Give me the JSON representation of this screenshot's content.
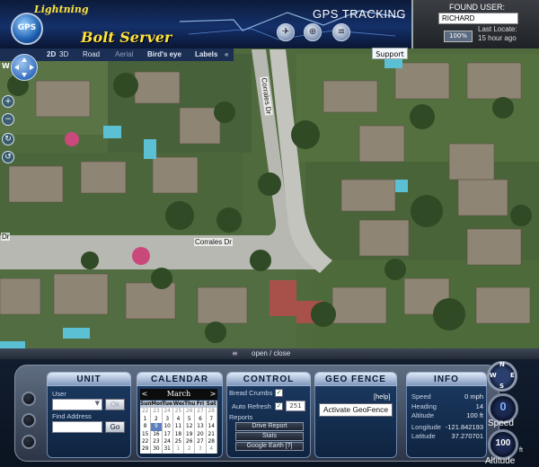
{
  "header": {
    "brand_script": "Lightning",
    "logo_text": "GPS",
    "brand_name": "Bolt Server",
    "title": "GPS TRACKING"
  },
  "found_user": {
    "label": "FOUND USER:",
    "value": "RICHARD",
    "zoom": "100%",
    "last_locate_label": "Last Locate:",
    "last_locate_value": "15 hour ago"
  },
  "map_tabs": [
    "2D",
    "3D",
    "Road",
    "Aerial",
    "Bird's eye",
    "Labels",
    "«"
  ],
  "support_label": "Support",
  "map": {
    "roads": [
      "Corrales Dr",
      "Corrales Dr",
      "Corrales Dr",
      "Dr"
    ],
    "nav_left_letter": "W"
  },
  "open_close_label": "open / close",
  "unit": {
    "title": "UNIT",
    "user_label": "User",
    "ok_label": "Ok",
    "find_address_label": "Find Address",
    "go_label": "Go",
    "user_value": "",
    "address_value": ""
  },
  "calendar": {
    "title": "CALENDAR",
    "month": "March",
    "prev": "<",
    "next": ">",
    "days": [
      "Sun",
      "Mon",
      "Tue",
      "Wed",
      "Thu",
      "Fri",
      "Sat"
    ],
    "weeks": [
      [
        "22",
        "23",
        "24",
        "25",
        "26",
        "27",
        "28"
      ],
      [
        "1",
        "2",
        "3",
        "4",
        "5",
        "6",
        "7"
      ],
      [
        "8",
        "9",
        "10",
        "11",
        "12",
        "13",
        "14"
      ],
      [
        "15",
        "16",
        "17",
        "18",
        "19",
        "20",
        "21"
      ],
      [
        "22",
        "23",
        "24",
        "25",
        "26",
        "27",
        "28"
      ],
      [
        "29",
        "30",
        "31",
        "1",
        "2",
        "3",
        "4"
      ]
    ]
  },
  "control": {
    "title": "CONTROL",
    "bread_crumbs_label": "Bread Crumbs",
    "auto_refresh_label": "Auto Refresh",
    "refresh_value": "251",
    "reports_label": "Reports",
    "drive_report_label": "Drive Report",
    "stats_label": "Stats",
    "google_earth_label": "Google Earth",
    "google_earth_suffix": "[?]"
  },
  "geo_fence": {
    "title": "GEO FENCE",
    "help_label": "[help]",
    "activate_label": "Activate GeoFence"
  },
  "info": {
    "title": "INFO",
    "rows": [
      {
        "key": "Speed",
        "value": "0 mph"
      },
      {
        "key": "Heading",
        "value": "14"
      },
      {
        "key": "Altitude",
        "value": "100 ft"
      },
      {
        "key": "Longitude",
        "value": "-121.842193"
      },
      {
        "key": "Latitude",
        "value": "37.270701"
      }
    ]
  },
  "gauges": {
    "compass": {
      "n": "N",
      "s": "S",
      "w": "W",
      "e": "E"
    },
    "speed_value": "0",
    "speed_label": "Speed",
    "altitude_value": "100",
    "altitude_label": "Altitude",
    "feet_unit": "ft"
  },
  "colors": {
    "map_grass": "#4d6a3a",
    "road": "#b8b8b2",
    "brand_yellow": "#ffe23d",
    "panel_blue": "#1c3b63"
  }
}
